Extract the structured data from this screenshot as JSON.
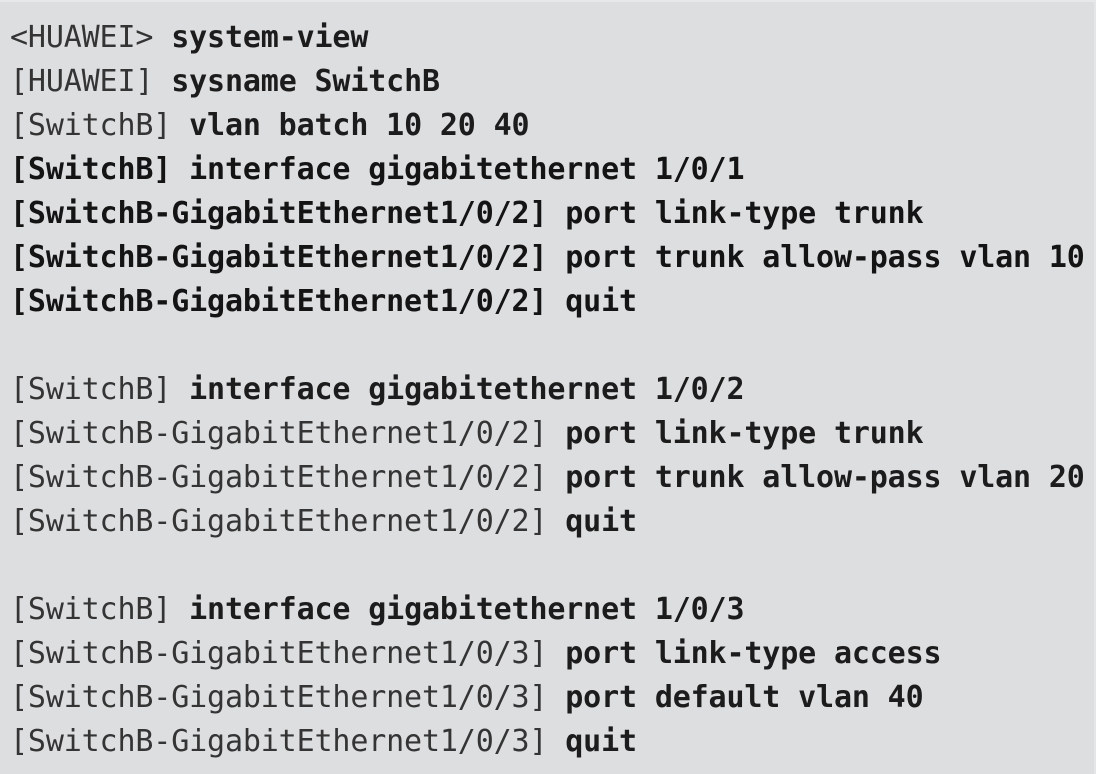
{
  "terminal": {
    "background_color": "#dcdee0",
    "text_color": "#2b2b2b",
    "device_initial_name": "HUAWEI",
    "device_new_name": "SwitchB",
    "lines": [
      {
        "prompt": "<HUAWEI> ",
        "command": "system-view",
        "bold_all": false,
        "blank": false
      },
      {
        "prompt": "[HUAWEI] ",
        "command": "sysname SwitchB",
        "bold_all": false,
        "blank": false
      },
      {
        "prompt": "[SwitchB] ",
        "command": "vlan batch 10 20 40",
        "bold_all": false,
        "blank": false
      },
      {
        "prompt": "[SwitchB] ",
        "command": "interface gigabitethernet 1/0/1",
        "bold_all": true,
        "blank": false
      },
      {
        "prompt": "[SwitchB-GigabitEthernet1/0/2] ",
        "command": "port link-type trunk",
        "bold_all": true,
        "blank": false
      },
      {
        "prompt": "[SwitchB-GigabitEthernet1/0/2] ",
        "command": "port trunk allow-pass vlan 10",
        "bold_all": true,
        "blank": false
      },
      {
        "prompt": "[SwitchB-GigabitEthernet1/0/2] ",
        "command": "quit",
        "bold_all": true,
        "blank": false
      },
      {
        "prompt": "",
        "command": "",
        "bold_all": false,
        "blank": true
      },
      {
        "prompt": "[SwitchB] ",
        "command": "interface gigabitethernet 1/0/2",
        "bold_all": false,
        "blank": false
      },
      {
        "prompt": "[SwitchB-GigabitEthernet1/0/2] ",
        "command": "port link-type trunk",
        "bold_all": false,
        "blank": false
      },
      {
        "prompt": "[SwitchB-GigabitEthernet1/0/2] ",
        "command": "port trunk allow-pass vlan 20",
        "bold_all": false,
        "blank": false
      },
      {
        "prompt": "[SwitchB-GigabitEthernet1/0/2] ",
        "command": "quit",
        "bold_all": false,
        "blank": false
      },
      {
        "prompt": "",
        "command": "",
        "bold_all": false,
        "blank": true
      },
      {
        "prompt": "[SwitchB] ",
        "command": "interface gigabitethernet 1/0/3",
        "bold_all": false,
        "blank": false
      },
      {
        "prompt": "[SwitchB-GigabitEthernet1/0/3] ",
        "command": "port link-type access",
        "bold_all": false,
        "blank": false
      },
      {
        "prompt": "[SwitchB-GigabitEthernet1/0/3] ",
        "command": "port default vlan 40",
        "bold_all": false,
        "blank": false
      },
      {
        "prompt": "[SwitchB-GigabitEthernet1/0/3] ",
        "command": "quit",
        "bold_all": false,
        "blank": false
      }
    ]
  }
}
